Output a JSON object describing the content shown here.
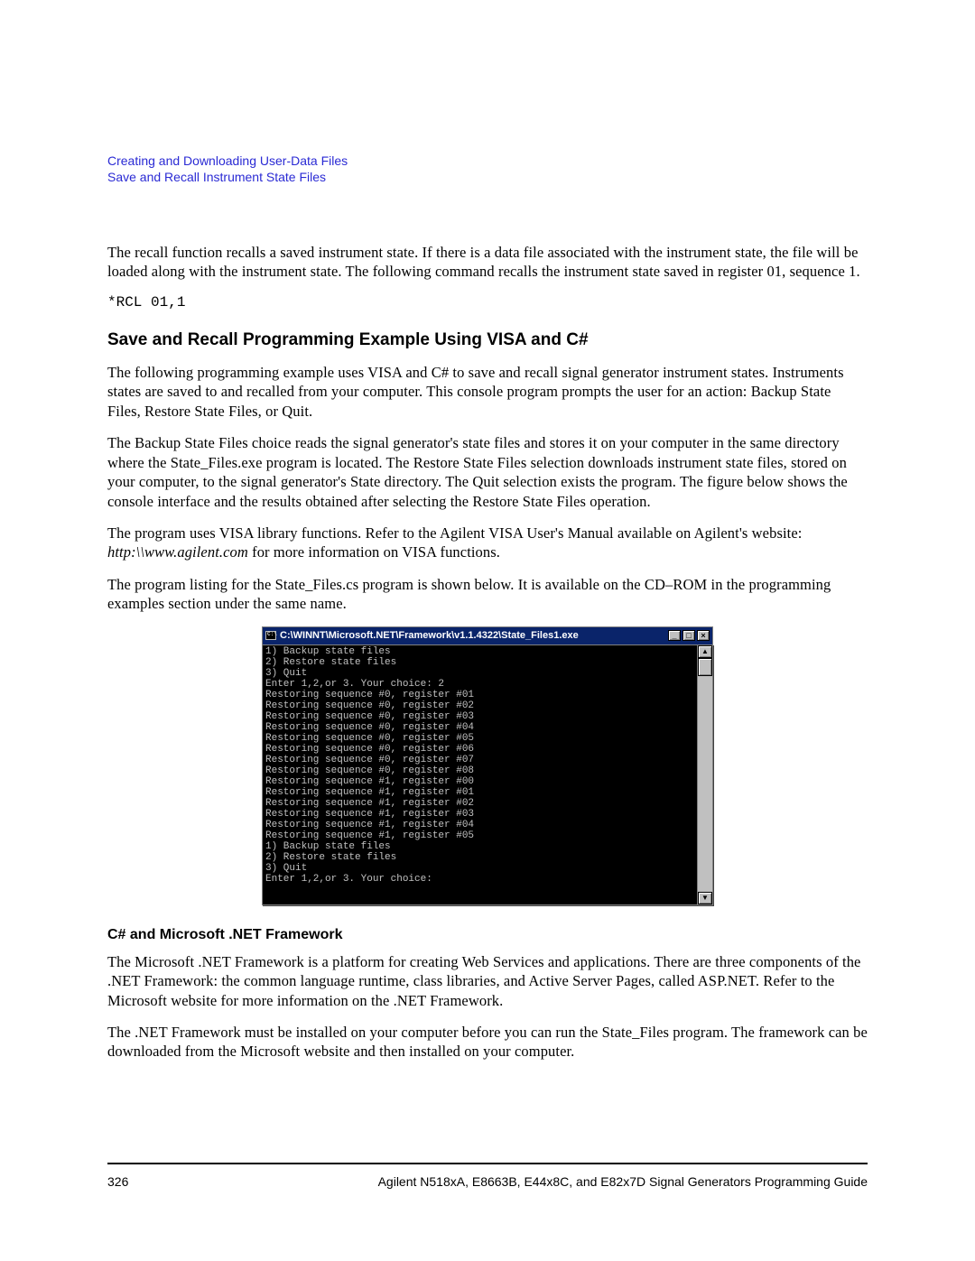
{
  "breadcrumb": {
    "line1": "Creating and Downloading User-Data Files",
    "line2": "Save and Recall Instrument State Files"
  },
  "para_recall": "The recall function recalls a saved instrument state. If there is a data file associated with the instrument state, the file will be loaded along with the instrument state. The following command recalls the instrument state saved in register 01, sequence 1.",
  "recall_cmd": "*RCL 01,1",
  "heading_main": "Save and Recall Programming Example Using VISA and C#",
  "para1": "The following programming example uses VISA and C# to save and recall signal generator instrument states. Instruments states are saved to and recalled from your computer. This console program prompts the user for an action: Backup State Files, Restore State Files, or Quit.",
  "para2": "The Backup State Files choice reads the signal generator's state files and stores it on your computer in the same directory where the State_Files.exe program is located. The Restore State Files selection downloads instrument state files, stored on your computer, to the signal generator's State directory. The Quit selection exists the program. The figure below shows the console interface and the results obtained after selecting the Restore State Files operation.",
  "para3_a": "The program uses VISA library functions. Refer to the Agilent VISA User's Manual available on Agilent's website: ",
  "para3_i": "http:\\\\www.agilent.com",
  "para3_b": " for more information on VISA functions.",
  "para4": "The program listing for the State_Files.cs program is shown below. It is available on the CD–ROM in the programming examples section under the same name.",
  "console": {
    "title": "C:\\WINNT\\Microsoft.NET\\Framework\\v1.1.4322\\State_Files1.exe",
    "lines": [
      "1) Backup state files",
      "2) Restore state files",
      "3) Quit",
      "Enter 1,2,or 3. Your choice: 2",
      "Restoring sequence #0, register #01",
      "Restoring sequence #0, register #02",
      "Restoring sequence #0, register #03",
      "Restoring sequence #0, register #04",
      "Restoring sequence #0, register #05",
      "Restoring sequence #0, register #06",
      "Restoring sequence #0, register #07",
      "Restoring sequence #0, register #08",
      "Restoring sequence #1, register #00",
      "Restoring sequence #1, register #01",
      "Restoring sequence #1, register #02",
      "Restoring sequence #1, register #03",
      "Restoring sequence #1, register #04",
      "Restoring sequence #1, register #05",
      "1) Backup state files",
      "2) Restore state files",
      "3) Quit",
      "Enter 1,2,or 3. Your choice:"
    ]
  },
  "heading_sub": "C# and Microsoft .NET Framework",
  "para5": "The Microsoft .NET Framework is a platform for creating Web Services and applications. There are three components of the .NET Framework: the common language runtime, class libraries, and Active Server Pages, called ASP.NET. Refer to the Microsoft website for more information on the .NET Framework.",
  "para6": "The .NET Framework must be installed on your computer before you can run the State_Files program. The framework can be downloaded from the Microsoft website and then installed on your computer.",
  "footer": {
    "page": "326",
    "text": "Agilent N518xA, E8663B, E44x8C, and E82x7D Signal Generators Programming Guide"
  },
  "winbtn": {
    "min": "_",
    "max": "□",
    "close": "×"
  },
  "scroll": {
    "up": "▲",
    "down": "▼"
  }
}
